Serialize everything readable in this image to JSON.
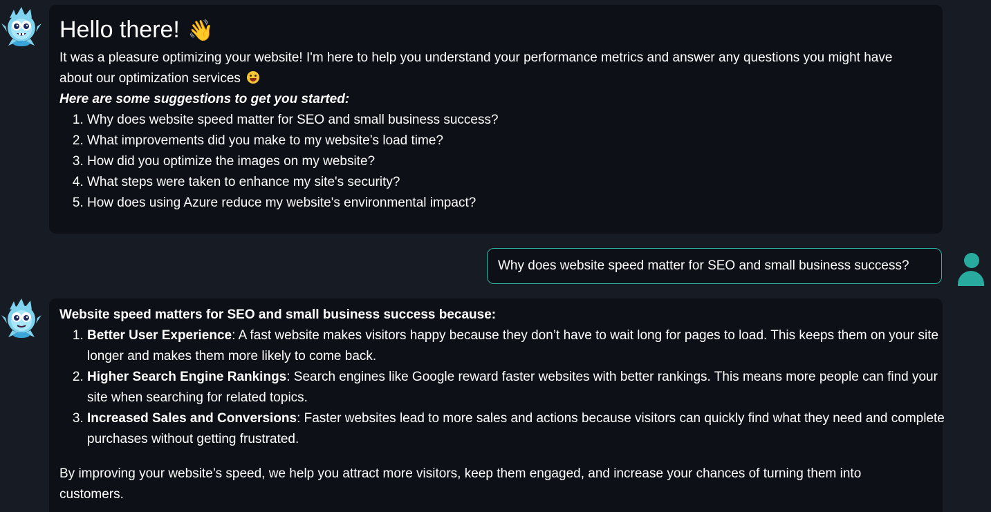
{
  "messages": {
    "bot1": {
      "greeting": "Hello there!",
      "greeting_emoji": "👋",
      "intro": "It was a pleasure optimizing your website! I'm here to help you understand your performance metrics and answer any questions you might have about our optimization services",
      "suggestions_title": "Here are some suggestions to get you started:",
      "suggestions": [
        "Why does website speed matter for SEO and small business success?",
        "What improvements did you make to my website’s load time?",
        "How did you optimize the images on my website?",
        "What steps were taken to enhance my site's security?",
        "How does using Azure reduce my website's environmental impact?"
      ]
    },
    "user1": {
      "text": "Why does website speed matter for SEO and small business success?"
    },
    "bot2": {
      "title": "Website speed matters for SEO and small business success because:",
      "points": [
        {
          "heading": "Better User Experience",
          "body": ": A fast website makes visitors happy because they don’t have to wait long for pages to load. This keeps them on your site longer and makes them more likely to come back."
        },
        {
          "heading": "Higher Search Engine Rankings",
          "body": ": Search engines like Google reward faster websites with better rankings. This means more people can find your site when searching for related topics."
        },
        {
          "heading": "Increased Sales and Conversions",
          "body": ": Faster websites lead to more sales and actions because visitors can quickly find what they need and complete purchases without getting frustrated."
        }
      ],
      "outro": "By improving your website’s speed, we help you attract more visitors, keep them engaged, and increase your chances of turning them into customers."
    }
  },
  "colors": {
    "background": "#171c24",
    "bubble": "#0d1016",
    "accent": "#2bb3a3"
  },
  "icons": {
    "bot_avatar": "fluffy-blue-monster-avatar-icon",
    "user_avatar": "person-icon",
    "wave": "waving-hand-emoji",
    "face": "grinning-tongue-emoji"
  }
}
